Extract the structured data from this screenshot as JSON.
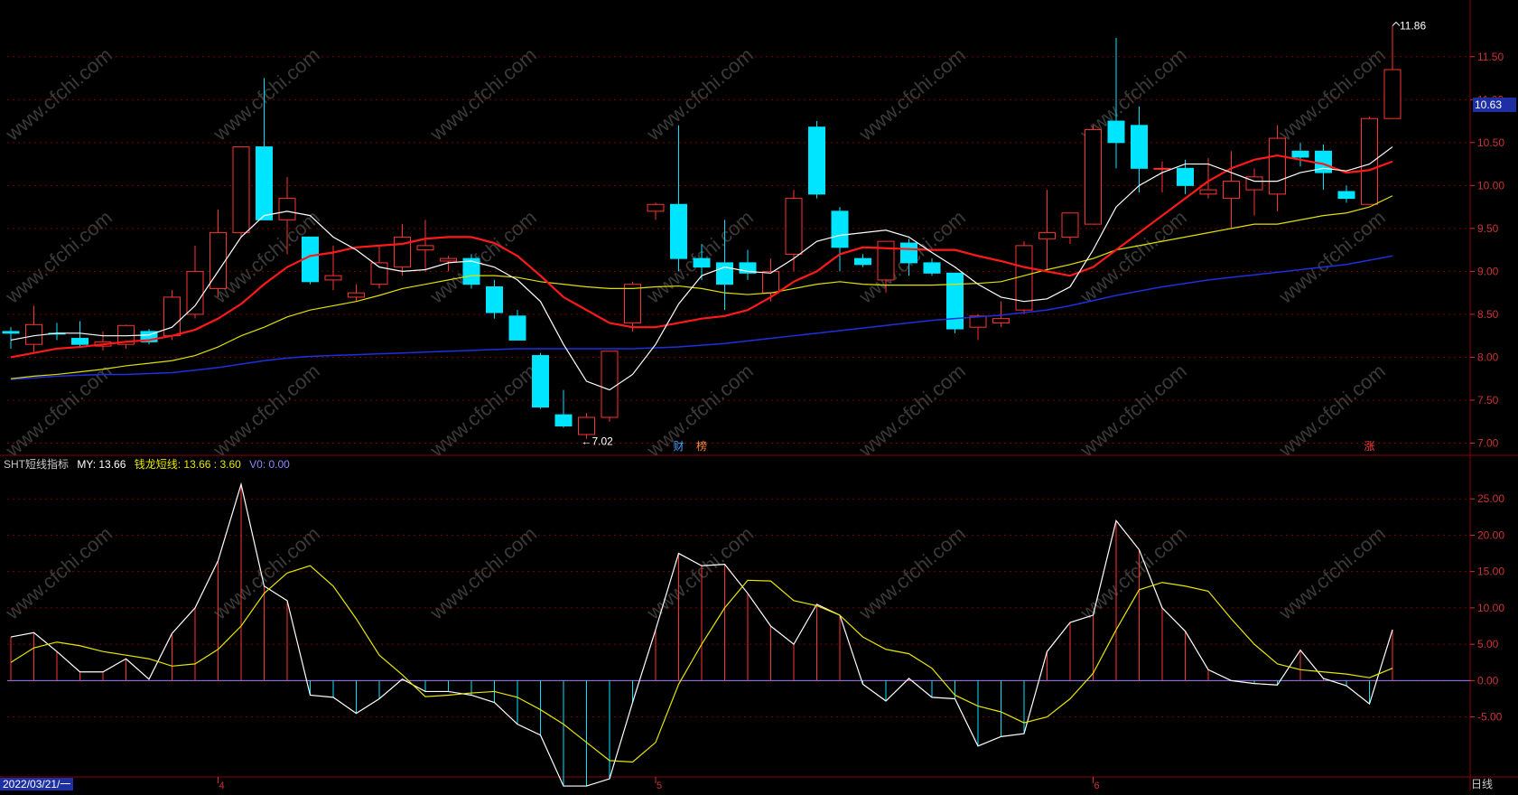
{
  "colors": {
    "background": "#000000",
    "up": "#ff3232",
    "down": "#00e5ff",
    "ma5": "#ffffff",
    "ma10": "#ff1a1a",
    "ma20": "#e0e000",
    "ma60": "#1f2fe0",
    "grid": "#7a0000",
    "axis_text": "#cc3333",
    "watermark": "#3a3a3a"
  },
  "watermark_text": "www.cfchi.com",
  "current_price": "10.63",
  "high_annotation": "11.86",
  "low_annotation": "←7.02",
  "markers": [
    {
      "text": "财",
      "index": 29,
      "color": "#4aa3ff"
    },
    {
      "text": "榜",
      "index": 30,
      "color": "#ff8a3a"
    },
    {
      "text": "涨",
      "index": 59,
      "color": "#ff4040"
    }
  ],
  "indicator": {
    "name": "SHT短线指标",
    "my_label": "MY: 13.66",
    "ql_label": "钱龙短线: 13.66 : 3.60",
    "v0_label": "V0: 0.00"
  },
  "date_start": "2022/03/21/一",
  "period": "日线",
  "chart_data": [
    {
      "type": "candlestick",
      "ylim": [
        6.9,
        11.95
      ],
      "y_ticks": [
        "11.50",
        "11.00",
        "10.50",
        "10.00",
        "9.50",
        "9.00",
        "8.50",
        "8.00",
        "7.50",
        "7.00"
      ],
      "x_ticks": [
        {
          "index": 9,
          "label": "4"
        },
        {
          "index": 28,
          "label": "5"
        },
        {
          "index": 47,
          "label": "6"
        }
      ],
      "ohlc": [
        [
          8.3,
          8.35,
          8.1,
          8.28
        ],
        [
          8.15,
          8.6,
          8.05,
          8.38
        ],
        [
          8.28,
          8.4,
          8.2,
          8.27
        ],
        [
          8.22,
          8.42,
          8.12,
          8.15
        ],
        [
          8.13,
          8.3,
          8.08,
          8.18
        ],
        [
          8.15,
          8.38,
          8.1,
          8.37
        ],
        [
          8.3,
          8.33,
          8.15,
          8.18
        ],
        [
          8.25,
          8.78,
          8.2,
          8.7
        ],
        [
          8.5,
          9.3,
          8.45,
          9.0
        ],
        [
          8.8,
          9.72,
          8.7,
          9.45
        ],
        [
          9.45,
          10.45,
          9.4,
          10.45
        ],
        [
          10.45,
          11.25,
          9.6,
          9.6
        ],
        [
          9.6,
          10.1,
          9.2,
          9.85
        ],
        [
          9.4,
          9.4,
          8.85,
          8.88
        ],
        [
          8.9,
          9.3,
          8.78,
          8.95
        ],
        [
          8.7,
          8.85,
          8.65,
          8.75
        ],
        [
          8.85,
          9.3,
          8.8,
          9.1
        ],
        [
          9.05,
          9.55,
          8.95,
          9.4
        ],
        [
          9.25,
          9.6,
          9.0,
          9.3
        ],
        [
          9.12,
          9.18,
          9.0,
          9.15
        ],
        [
          9.15,
          9.2,
          8.8,
          8.85
        ],
        [
          8.82,
          8.9,
          8.45,
          8.52
        ],
        [
          8.48,
          8.55,
          8.2,
          8.2
        ],
        [
          8.02,
          8.05,
          7.4,
          7.42
        ],
        [
          7.33,
          7.62,
          7.18,
          7.2
        ],
        [
          7.1,
          7.35,
          7.05,
          7.3
        ],
        [
          7.3,
          8.07,
          7.25,
          8.07
        ],
        [
          8.4,
          8.88,
          8.3,
          8.85
        ],
        [
          9.7,
          9.8,
          9.6,
          9.78
        ],
        [
          9.78,
          10.7,
          9.0,
          9.15
        ],
        [
          9.15,
          9.32,
          8.9,
          9.05
        ],
        [
          9.1,
          9.6,
          8.55,
          8.85
        ],
        [
          9.1,
          9.25,
          8.9,
          8.98
        ],
        [
          8.75,
          9.15,
          8.65,
          9.0
        ],
        [
          9.2,
          9.95,
          9.0,
          9.85
        ],
        [
          10.68,
          10.75,
          9.85,
          9.9
        ],
        [
          9.7,
          9.75,
          9.0,
          9.28
        ],
        [
          9.15,
          9.2,
          9.05,
          9.08
        ],
        [
          8.9,
          9.3,
          8.75,
          9.35
        ],
        [
          9.33,
          9.38,
          8.95,
          9.1
        ],
        [
          9.1,
          9.15,
          8.95,
          8.98
        ],
        [
          8.98,
          8.98,
          8.28,
          8.33
        ],
        [
          8.35,
          8.5,
          8.2,
          8.48
        ],
        [
          8.4,
          8.65,
          8.35,
          8.45
        ],
        [
          8.55,
          9.35,
          8.5,
          9.3
        ],
        [
          9.38,
          9.95,
          9.0,
          9.45
        ],
        [
          9.4,
          9.55,
          9.32,
          9.68
        ],
        [
          9.55,
          10.7,
          9.55,
          10.65
        ],
        [
          10.75,
          11.72,
          10.2,
          10.5
        ],
        [
          10.7,
          10.92,
          9.92,
          10.2
        ],
        [
          10.2,
          10.28,
          9.92,
          10.2
        ],
        [
          10.2,
          10.3,
          9.9,
          10.0
        ],
        [
          9.9,
          10.32,
          9.85,
          9.95
        ],
        [
          9.85,
          10.4,
          9.5,
          10.05
        ],
        [
          9.95,
          10.2,
          9.65,
          10.1
        ],
        [
          9.9,
          10.7,
          9.7,
          10.55
        ],
        [
          10.4,
          10.5,
          10.22,
          10.33
        ],
        [
          10.4,
          10.48,
          9.95,
          10.15
        ],
        [
          9.93,
          10.0,
          9.8,
          9.85
        ],
        [
          9.78,
          10.8,
          9.78,
          10.78
        ],
        [
          10.78,
          11.86,
          10.78,
          11.35
        ]
      ],
      "ma5": [
        8.2,
        8.25,
        8.28,
        8.28,
        8.25,
        8.25,
        8.26,
        8.35,
        8.6,
        9.0,
        9.4,
        9.65,
        9.7,
        9.65,
        9.4,
        9.25,
        9.05,
        9.0,
        9.02,
        9.1,
        9.12,
        9.05,
        8.9,
        8.65,
        8.15,
        7.72,
        7.62,
        7.8,
        8.15,
        8.62,
        8.95,
        9.05,
        9.0,
        8.98,
        9.15,
        9.35,
        9.42,
        9.45,
        9.48,
        9.4,
        9.22,
        9.05,
        8.85,
        8.7,
        8.65,
        8.68,
        8.82,
        9.25,
        9.75,
        10.0,
        10.15,
        10.25,
        10.25,
        10.15,
        10.05,
        10.05,
        10.15,
        10.2,
        10.17,
        10.25,
        10.45
      ],
      "ma10": [
        8.0,
        8.05,
        8.1,
        8.12,
        8.15,
        8.18,
        8.2,
        8.25,
        8.32,
        8.45,
        8.62,
        8.85,
        9.05,
        9.18,
        9.22,
        9.28,
        9.3,
        9.32,
        9.38,
        9.4,
        9.4,
        9.33,
        9.18,
        8.95,
        8.7,
        8.55,
        8.4,
        8.35,
        8.35,
        8.4,
        8.45,
        8.48,
        8.55,
        8.7,
        8.88,
        9.0,
        9.2,
        9.28,
        9.27,
        9.26,
        9.25,
        9.25,
        9.18,
        9.12,
        9.05,
        9.0,
        8.95,
        9.05,
        9.25,
        9.45,
        9.65,
        9.85,
        10.05,
        10.2,
        10.3,
        10.35,
        10.3,
        10.25,
        10.15,
        10.18,
        10.28
      ],
      "ma20": [
        7.75,
        7.78,
        7.8,
        7.83,
        7.86,
        7.9,
        7.93,
        7.96,
        8.02,
        8.12,
        8.25,
        8.35,
        8.47,
        8.55,
        8.6,
        8.65,
        8.72,
        8.8,
        8.85,
        8.9,
        8.95,
        8.95,
        8.93,
        8.88,
        8.85,
        8.82,
        8.8,
        8.8,
        8.82,
        8.83,
        8.8,
        8.75,
        8.73,
        8.75,
        8.8,
        8.85,
        8.88,
        8.85,
        8.84,
        8.84,
        8.84,
        8.85,
        8.86,
        8.88,
        8.95,
        9.02,
        9.08,
        9.15,
        9.25,
        9.3,
        9.35,
        9.4,
        9.45,
        9.5,
        9.55,
        9.55,
        9.6,
        9.65,
        9.68,
        9.75,
        9.88
      ],
      "ma60": [
        7.74,
        7.76,
        7.78,
        7.79,
        7.8,
        7.8,
        7.81,
        7.82,
        7.85,
        7.88,
        7.92,
        7.96,
        7.99,
        8.01,
        8.02,
        8.03,
        8.04,
        8.05,
        8.06,
        8.07,
        8.08,
        8.09,
        8.1,
        8.1,
        8.1,
        8.1,
        8.1,
        8.1,
        8.11,
        8.12,
        8.14,
        8.16,
        8.19,
        8.22,
        8.25,
        8.28,
        8.31,
        8.34,
        8.37,
        8.4,
        8.43,
        8.45,
        8.47,
        8.49,
        8.52,
        8.55,
        8.6,
        8.66,
        8.72,
        8.77,
        8.82,
        8.86,
        8.9,
        8.93,
        8.96,
        8.99,
        9.02,
        9.05,
        9.08,
        9.13,
        9.18
      ]
    },
    {
      "type": "line",
      "ylim": [
        -13.0,
        29.0
      ],
      "y_ticks": [
        "25.00",
        "20.00",
        "15.00",
        "10.00",
        "5.00",
        "0.00",
        "-5.00"
      ],
      "series": [
        {
          "name": "MY",
          "values": [
            6.0,
            6.6,
            4.0,
            1.2,
            1.2,
            3.0,
            0.2,
            6.5,
            10.0,
            16.5,
            27.0,
            13.0,
            11.0,
            -2.0,
            -2.3,
            -4.5,
            -2.5,
            0.2,
            -1.5,
            -1.5,
            -2.0,
            -3.0,
            -6.0,
            -7.5,
            -14.5,
            -14.5,
            -13.5,
            -3.0,
            7.0,
            17.5,
            15.8,
            16.0,
            12.0,
            7.5,
            5.0,
            10.5,
            9.0,
            -0.5,
            -2.8,
            0.3,
            -2.3,
            -2.5,
            -9.0,
            -7.7,
            -7.3,
            4.0,
            8.0,
            9.0,
            22.0,
            18.0,
            10.0,
            6.8,
            1.5,
            0.0,
            -0.4,
            -0.6,
            4.2,
            0.3,
            -0.7,
            -3.2,
            7.0,
            13.66
          ]
        },
        {
          "name": "钱龙短线",
          "values": [
            2.5,
            4.5,
            5.3,
            4.8,
            4.0,
            3.5,
            3.0,
            2.0,
            2.3,
            4.3,
            7.5,
            12.0,
            14.8,
            15.8,
            13.0,
            8.5,
            3.5,
            0.8,
            -2.2,
            -2.0,
            -1.7,
            -1.5,
            -2.3,
            -4.0,
            -6.0,
            -8.5,
            -11.0,
            -11.2,
            -8.5,
            -0.5,
            5.0,
            10.0,
            13.8,
            13.7,
            11.0,
            10.3,
            9.0,
            6.0,
            4.3,
            3.7,
            1.7,
            -2.0,
            -3.5,
            -4.3,
            -5.8,
            -5.0,
            -2.5,
            1.0,
            7.0,
            12.5,
            13.5,
            13.0,
            12.3,
            8.5,
            5.0,
            2.3,
            1.5,
            1.2,
            0.9,
            0.4,
            1.7,
            3.6
          ]
        }
      ]
    }
  ]
}
